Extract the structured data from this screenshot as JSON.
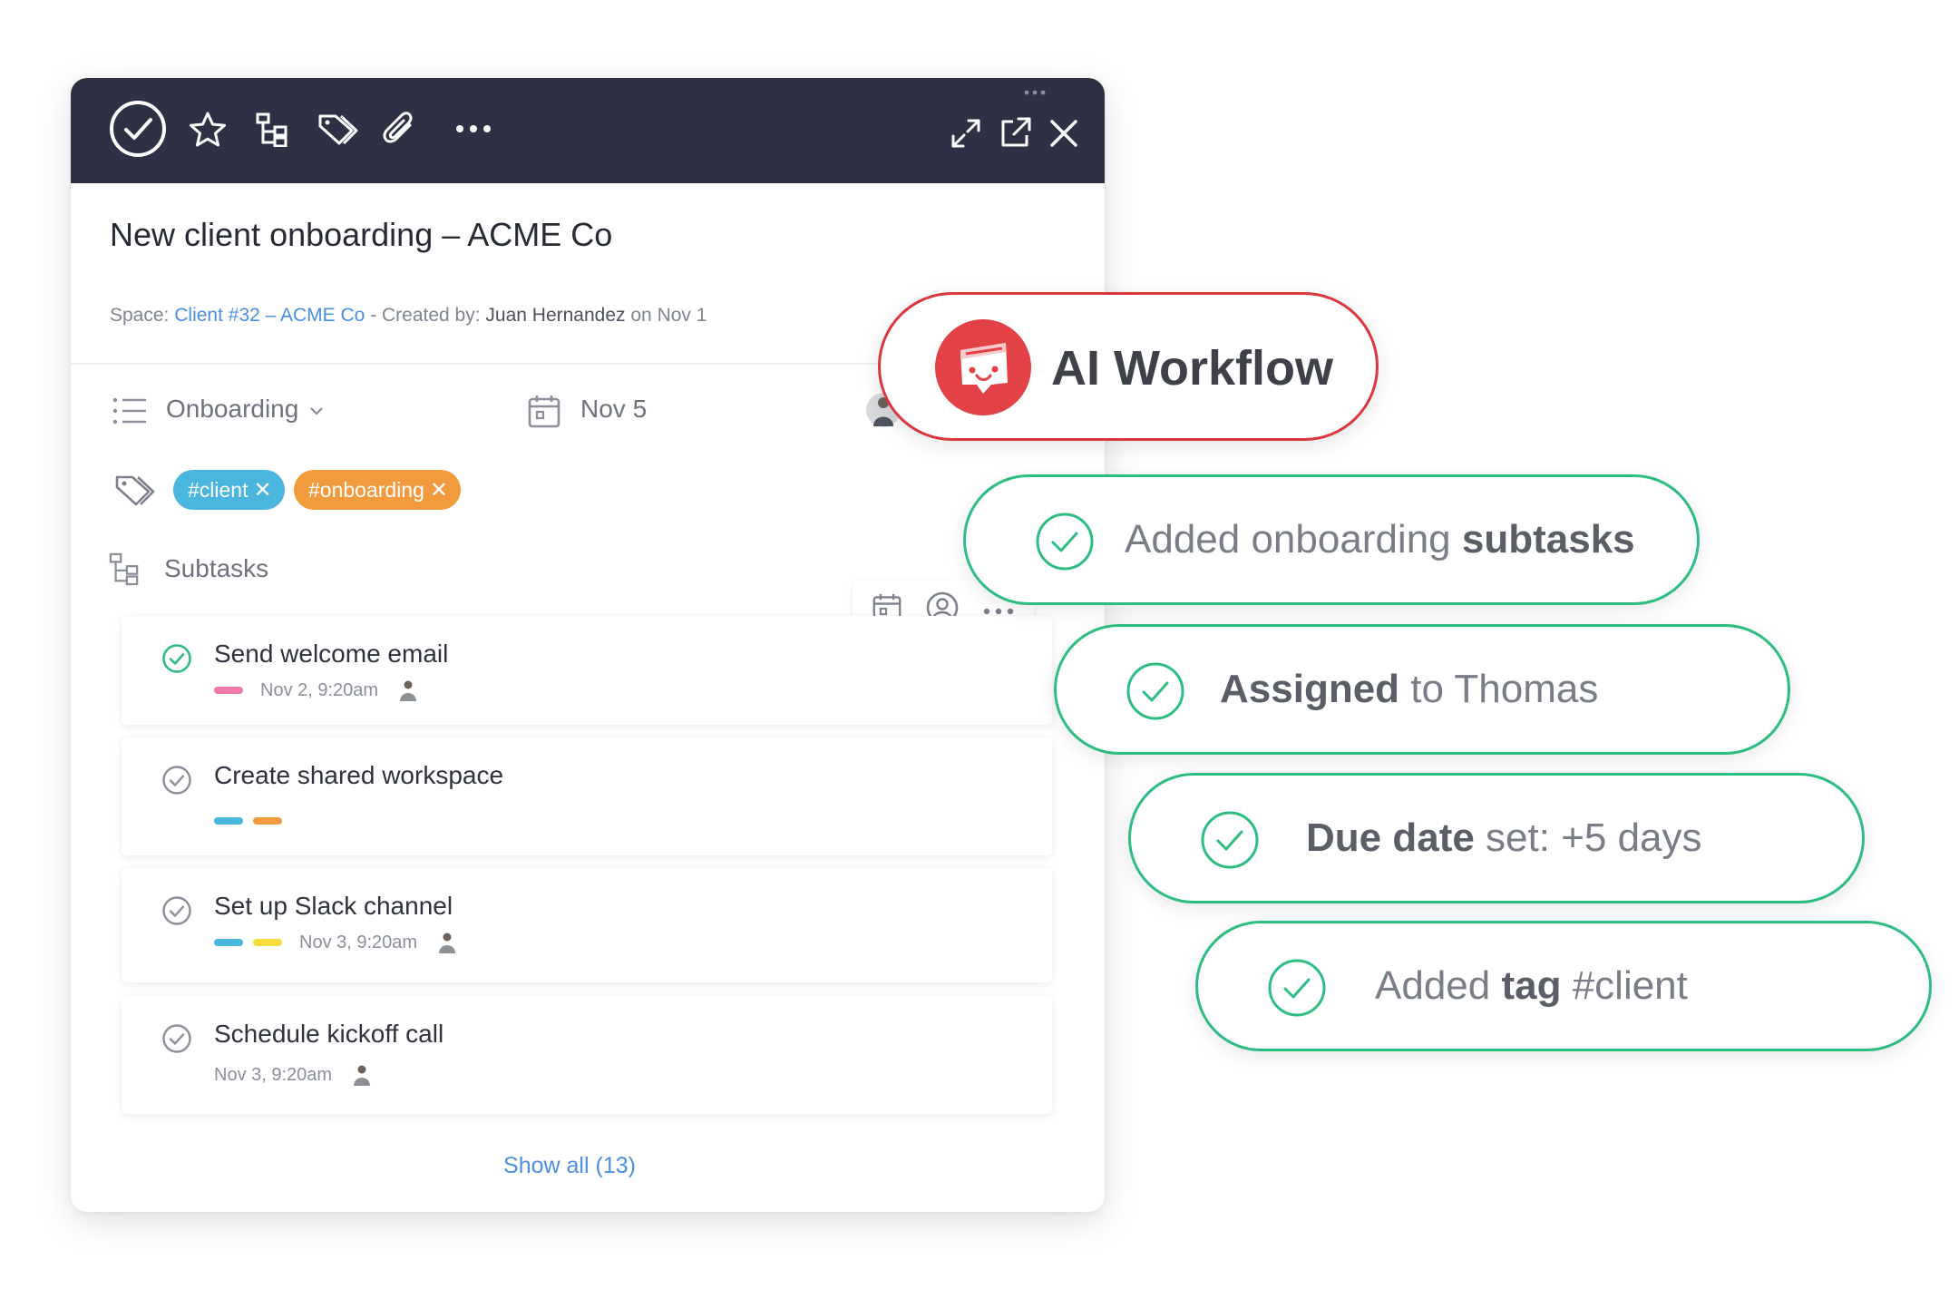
{
  "toolbar": {
    "icons": [
      "check-circle-icon",
      "star-icon",
      "subtasks-icon",
      "tags-icon",
      "paperclip-icon",
      "more-icon",
      "expand-icon",
      "open-external-icon",
      "close-icon"
    ]
  },
  "task": {
    "title": "New client onboarding – ACME Co",
    "meta": {
      "space_label": "Space:",
      "space_value": "Client #32 – ACME Co",
      "created_by_label": "- Created by:",
      "created_by_value": "Juan Hernandez",
      "on_label": "on",
      "created_date": "Nov 1"
    },
    "status": "Onboarding",
    "due_date": "Nov 5",
    "tags": [
      {
        "label": "#client",
        "color": "#4ab5dd"
      },
      {
        "label": "#onboarding",
        "color": "#f19a3e"
      }
    ],
    "subtasks_label": "Subtasks",
    "subtasks": [
      {
        "name": "Send welcome email",
        "done": true,
        "date": "Nov 2, 9:20am",
        "tag_colors": [
          "#f27aaa"
        ]
      },
      {
        "name": "Create shared workspace",
        "done": false,
        "date": "",
        "tag_colors": [
          "#4ab5dd",
          "#f19a3e"
        ]
      },
      {
        "name": "Set up Slack channel",
        "done": false,
        "date": "Nov 3, 9:20am",
        "tag_colors": [
          "#4ab5dd",
          "#f5dd3c"
        ]
      },
      {
        "name": "Schedule kickoff call",
        "done": false,
        "date": "Nov 3, 9:20am",
        "tag_colors": []
      }
    ],
    "show_all": "Show all (13)"
  },
  "ai_workflow": {
    "label": "AI Workflow",
    "accent": "#d9363e",
    "steps": [
      {
        "pre": "Added onboarding ",
        "bold": "subtasks",
        "post": ""
      },
      {
        "pre": "",
        "bold": "Assigned",
        "post": " to Thomas"
      },
      {
        "pre": "",
        "bold": "Due date",
        "post": " set: +5 days"
      },
      {
        "pre": "Added ",
        "bold": "tag",
        "post": " #client"
      }
    ],
    "step_color": "#2ebd81"
  }
}
